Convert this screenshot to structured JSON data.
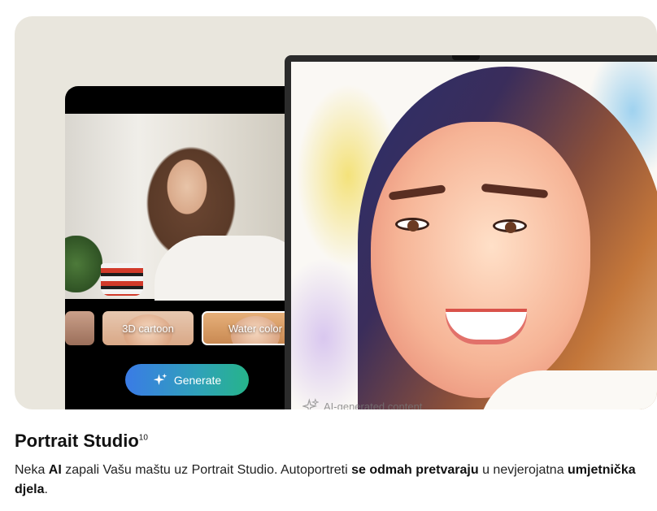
{
  "hero": {
    "phone": {
      "styles": [
        {
          "label": ""
        },
        {
          "label": "3D cartoon"
        },
        {
          "label": "Water color"
        }
      ],
      "generate_label": "Generate"
    },
    "tablet": {
      "ai_badge": "AI-generated content"
    }
  },
  "section": {
    "title": "Portrait Studio",
    "footnote": "10",
    "desc": {
      "p1": "Neka ",
      "b1": "AI",
      "p2": " zapali Vašu maštu uz Portrait Studio. Autoportreti ",
      "b2": "se odmah pretvaraju",
      "p3": " u nevjerojatna ",
      "b3": "umjetnička djela",
      "p4": "."
    }
  },
  "colors": {
    "hero_bg": "#e9e6dd",
    "generate_gradient_start": "#3a7be6",
    "generate_gradient_end": "#26b48a"
  }
}
